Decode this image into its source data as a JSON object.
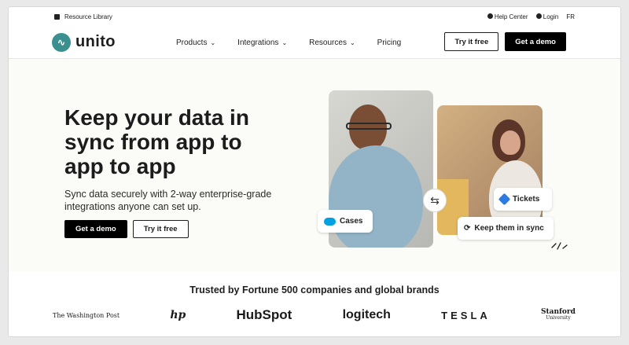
{
  "topbar": {
    "resource_library": "Resource Library",
    "help_center": "Help Center",
    "login": "Login",
    "language": "FR"
  },
  "header": {
    "logo_text": "unito",
    "nav": {
      "products": "Products",
      "integrations": "Integrations",
      "resources": "Resources",
      "pricing": "Pricing"
    },
    "try_free": "Try it free",
    "get_demo": "Get a demo"
  },
  "hero": {
    "title": "Keep your data in sync from app to app to app",
    "subtitle": "Sync data securely with 2-way enterprise-grade integrations anyone can set up.",
    "demo_button": "Get a demo",
    "try_button": "Try it free"
  },
  "badges": {
    "cases": "Cases",
    "tickets": "Tickets",
    "keep_sync": "Keep them in sync"
  },
  "trusted": {
    "heading": "Trusted by Fortune 500 companies and global brands",
    "logos": [
      "The Washington Post",
      "hp",
      "HubSpot",
      "logitech",
      "TESLA",
      "Stanford",
      "University"
    ]
  },
  "colors": {
    "brand_teal": "#3b8f8e",
    "salesforce_blue": "#00a1e0",
    "jira_blue": "#2c7be5",
    "black": "#000000"
  },
  "icons": [
    "book-icon",
    "question-icon",
    "user-icon",
    "chevron-down-icon",
    "sync-arrows-icon",
    "salesforce-icon",
    "jira-icon",
    "refresh-icon",
    "spark-lines-icon"
  ]
}
